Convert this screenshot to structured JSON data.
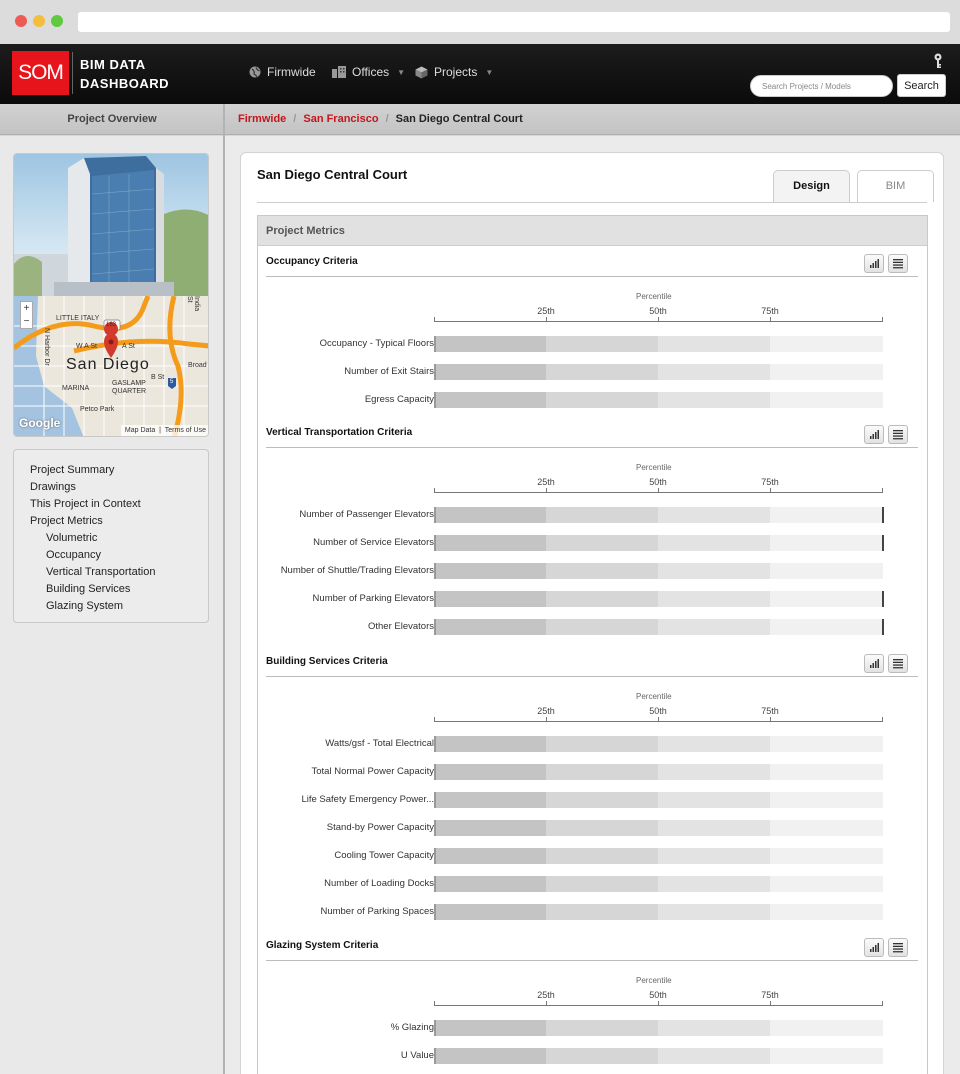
{
  "app": {
    "logo": "SOM",
    "title_line1": "BIM DATA",
    "title_line2": "DASHBOARD"
  },
  "nav": {
    "firmwide": "Firmwide",
    "offices": "Offices",
    "projects": "Projects"
  },
  "search": {
    "placeholder": "Search Projects / Models",
    "button": "Search"
  },
  "subbar": {
    "left_title": "Project Overview"
  },
  "breadcrumb": {
    "firmwide": "Firmwide",
    "office": "San Francisco",
    "current": "San Diego Central Court"
  },
  "map": {
    "city": "San Diego",
    "streets": [
      "LITTLE ITALY",
      "W A St",
      "A St",
      "MARINA",
      "GASLAMP QUARTER",
      "Petco Park",
      "N Harbor Dr",
      "Broad",
      "B St",
      "India St"
    ],
    "routes": [
      "163",
      "5"
    ],
    "zoom_in": "+",
    "zoom_out": "−",
    "google": "Google",
    "map_data": "Map Data",
    "terms": "Terms of Use"
  },
  "sidebar": {
    "items": [
      {
        "label": "Project Summary",
        "sub": false
      },
      {
        "label": "Drawings",
        "sub": false
      },
      {
        "label": "This Project in Context",
        "sub": false
      },
      {
        "label": "Project Metrics",
        "sub": false
      },
      {
        "label": "Volumetric",
        "sub": true
      },
      {
        "label": "Occupancy",
        "sub": true
      },
      {
        "label": "Vertical Transportation",
        "sub": true
      },
      {
        "label": "Building Services",
        "sub": true
      },
      {
        "label": "Glazing System",
        "sub": true
      }
    ]
  },
  "project": {
    "title": "San Diego Central Court",
    "tabs": {
      "design": "Design",
      "bim": "BIM"
    }
  },
  "metrics": {
    "header": "Project Metrics",
    "percentile_label": "Percentile",
    "ticks": [
      "25th",
      "50th",
      "75th"
    ],
    "sections": [
      {
        "title": "Occupancy Criteria",
        "rows": [
          {
            "label": "Occupancy - Typical Floors",
            "marker": false
          },
          {
            "label": "Number of Exit Stairs",
            "marker": false
          },
          {
            "label": "Egress Capacity",
            "marker": false
          }
        ]
      },
      {
        "title": "Vertical Transportation Criteria",
        "rows": [
          {
            "label": "Number of Passenger Elevators",
            "marker": true
          },
          {
            "label": "Number of Service Elevators",
            "marker": true
          },
          {
            "label": "Number of Shuttle/Trading Elevators",
            "marker": false
          },
          {
            "label": "Number of Parking Elevators",
            "marker": true
          },
          {
            "label": "Other Elevators",
            "marker": true
          }
        ]
      },
      {
        "title": "Building Services Criteria",
        "rows": [
          {
            "label": "Watts/gsf - Total Electrical",
            "marker": false
          },
          {
            "label": "Total Normal Power Capacity",
            "marker": false
          },
          {
            "label": "Life Safety Emergency Power...",
            "marker": false
          },
          {
            "label": "Stand-by Power Capacity",
            "marker": false
          },
          {
            "label": "Cooling Tower Capacity",
            "marker": false
          },
          {
            "label": "Number of Loading Docks",
            "marker": false
          },
          {
            "label": "Number of Parking Spaces",
            "marker": false
          }
        ]
      },
      {
        "title": "Glazing System Criteria",
        "rows": [
          {
            "label": "% Glazing",
            "marker": false
          },
          {
            "label": "U Value",
            "marker": false
          }
        ]
      }
    ]
  },
  "colors": {
    "brand_red": "#e8141c",
    "link_red": "#c4161c",
    "nav_bg": "#111111"
  }
}
